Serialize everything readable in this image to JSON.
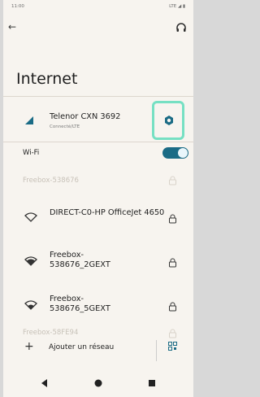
{
  "status": {
    "time": "11:00",
    "right": "LTE ◢ ▮"
  },
  "page_title": "Internet",
  "mobile": {
    "name": "Telenor CXN 3692",
    "status": "Connecté/LTE"
  },
  "wifi": {
    "label": "Wi-Fi",
    "enabled": true
  },
  "networks": [
    {
      "name": "Freebox-538676",
      "disabled": true
    },
    {
      "name": "DIRECT-C0-HP OfficeJet 4650",
      "disabled": false
    },
    {
      "name": "Freebox-538676_2GEXT",
      "disabled": false
    },
    {
      "name": "Freebox-538676_5GEXT",
      "disabled": false
    },
    {
      "name": "Freebox-58FE94",
      "disabled": true
    }
  ],
  "add_network": {
    "label": "Ajouter un réseau"
  },
  "colors": {
    "background": "#f7f4ef",
    "accent": "#1a6b85",
    "highlight": "#76e0c3"
  }
}
